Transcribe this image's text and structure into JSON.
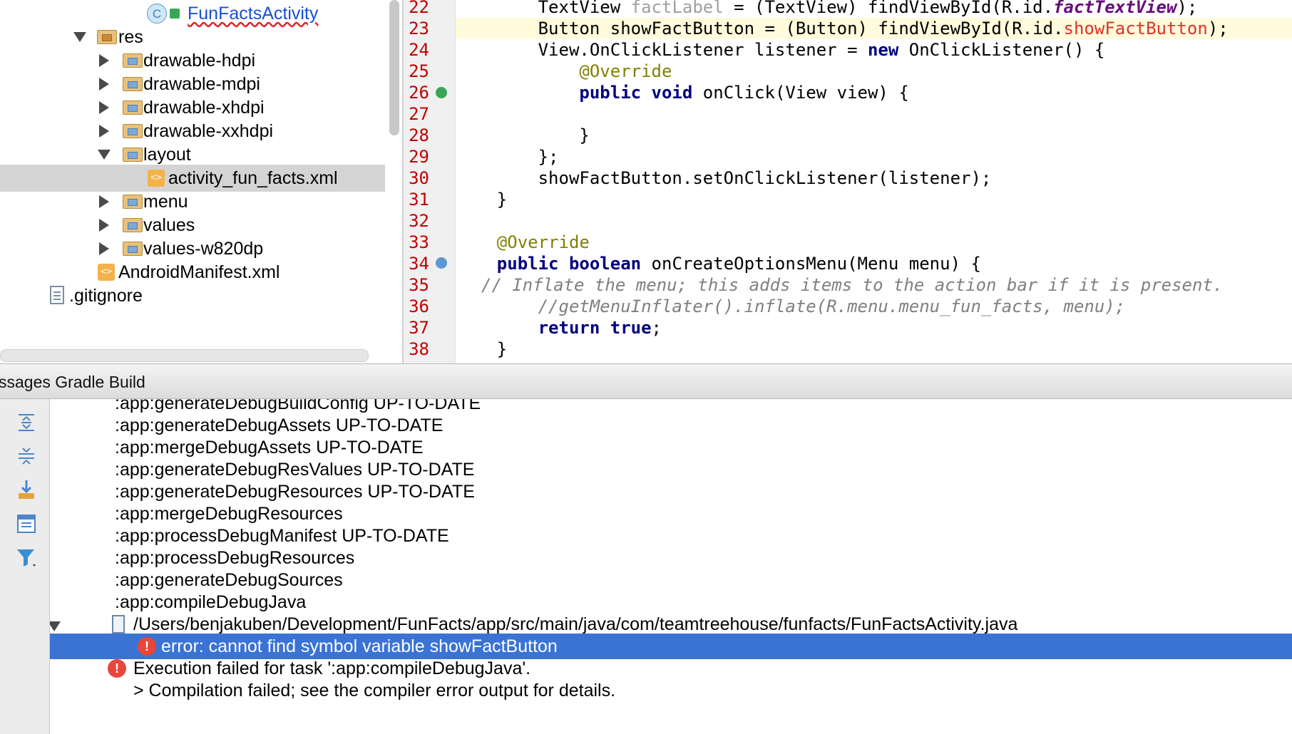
{
  "project_tree": {
    "items": [
      {
        "label": "FunFactsActivity",
        "type": "class"
      },
      {
        "label": "res",
        "type": "res-folder",
        "expanded": true
      },
      {
        "label": "drawable-hdpi",
        "type": "folder"
      },
      {
        "label": "drawable-mdpi",
        "type": "folder"
      },
      {
        "label": "drawable-xhdpi",
        "type": "folder"
      },
      {
        "label": "drawable-xxhdpi",
        "type": "folder"
      },
      {
        "label": "layout",
        "type": "folder",
        "expanded": true
      },
      {
        "label": "activity_fun_facts.xml",
        "type": "xml",
        "selected": true
      },
      {
        "label": "menu",
        "type": "folder"
      },
      {
        "label": "values",
        "type": "folder"
      },
      {
        "label": "values-w820dp",
        "type": "folder"
      },
      {
        "label": "AndroidManifest.xml",
        "type": "xml"
      },
      {
        "label": ".gitignore",
        "type": "file"
      }
    ]
  },
  "editor": {
    "line_numbers": [
      "22",
      "23",
      "24",
      "25",
      "26",
      "27",
      "28",
      "29",
      "30",
      "31",
      "32",
      "33",
      "34",
      "35",
      "36",
      "37",
      "38"
    ],
    "code": {
      "l22": {
        "a": "        TextView ",
        "b": "factLabel",
        "c": " = (TextView) findViewById(R.id.",
        "d": "factTextView",
        "e": ");"
      },
      "l23": {
        "a": "        Button showFactButton = (Button) findViewById(R.id.",
        "b": "showFactButton",
        "c": ");"
      },
      "l24": {
        "a": "        View.OnClickListener listener = ",
        "b": "new",
        "c": " OnClickListener() {"
      },
      "l25": {
        "a": "            ",
        "b": "@Override"
      },
      "l26": {
        "a": "            ",
        "b": "public void",
        "c": " onClick(View view) {"
      },
      "l27": {
        "a": ""
      },
      "l28": {
        "a": "            }"
      },
      "l29": {
        "a": "        };"
      },
      "l30": {
        "a": "        showFactButton.setOnClickListener(listener);"
      },
      "l31": {
        "a": "    }"
      },
      "l32": {
        "a": ""
      },
      "l33": {
        "a": "    ",
        "b": "@Override"
      },
      "l34": {
        "a": "    ",
        "b": "public boolean",
        "c": " onCreateOptionsMenu(Menu menu) {"
      },
      "l35": {
        "a": "",
        "b": "// Inflate the menu; this adds items to the action bar if it is present."
      },
      "l36": {
        "a": "        ",
        "b": "//getMenuInflater().inflate(R.menu.menu_fun_facts, menu);"
      },
      "l37": {
        "a": "        ",
        "b": "return true",
        "c": ";"
      },
      "l38": {
        "a": "    }"
      }
    }
  },
  "tool_window": {
    "title": "ssages Gradle Build",
    "messages": [
      ":app:generateDebugBuildConfig UP-TO-DATE",
      ":app:generateDebugAssets UP-TO-DATE",
      ":app:mergeDebugAssets UP-TO-DATE",
      ":app:generateDebugResValues UP-TO-DATE",
      ":app:generateDebugResources UP-TO-DATE",
      ":app:mergeDebugResources",
      ":app:processDebugManifest UP-TO-DATE",
      ":app:processDebugResources",
      ":app:generateDebugSources",
      ":app:compileDebugJava"
    ],
    "file_path": "/Users/benjakuben/Development/FunFacts/app/src/main/java/com/teamtreehouse/funfacts/FunFactsActivity.java",
    "error_message": "error: cannot find symbol variable showFactButton",
    "execution_failed": "Execution failed for task ':app:compileDebugJava'.",
    "compilation_failed": "> Compilation failed; see the compiler error output for details."
  },
  "icons": {
    "error": "!",
    "class": "C",
    "xml": "<>"
  },
  "colors": {
    "selection": "#3b73d4",
    "error_red": "#e8463a",
    "keyword": "#000080",
    "annotation": "#808000",
    "line_number": "#c00000"
  }
}
